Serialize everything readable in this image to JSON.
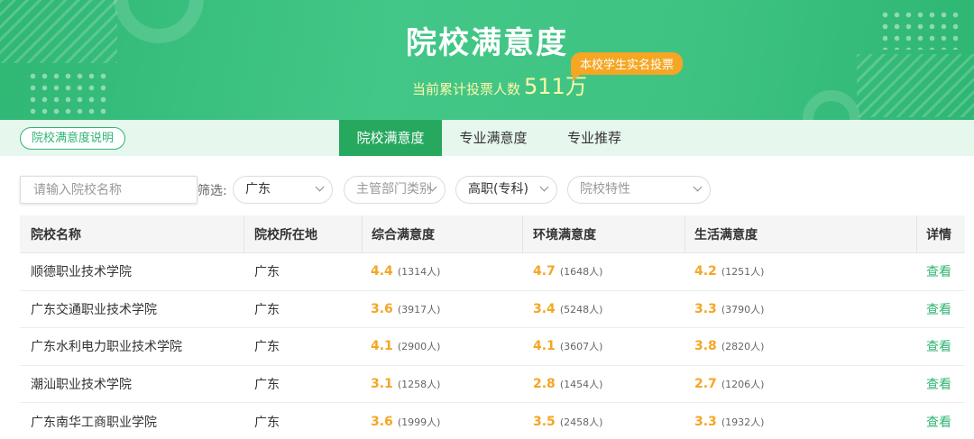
{
  "banner": {
    "title": "院校满意度",
    "vote_label": "当前累计投票人数",
    "vote_count": "511万",
    "badge": "本校学生实名投票"
  },
  "tabs": {
    "explain_button": "院校满意度说明",
    "items": [
      {
        "label": "院校满意度",
        "active": true
      },
      {
        "label": "专业满意度",
        "active": false
      },
      {
        "label": "专业推荐",
        "active": false
      }
    ]
  },
  "filters": {
    "search_placeholder": "请输入院校名称",
    "label": "筛选:",
    "region": "广东",
    "department_placeholder": "主管部门类别",
    "level": "高职(专科)",
    "feature_placeholder": "院校特性"
  },
  "table": {
    "headers": [
      "院校名称",
      "院校所在地",
      "综合满意度",
      "环境满意度",
      "生活满意度",
      "详情"
    ],
    "rows": [
      {
        "name": "顺德职业技术学院",
        "location": "广东",
        "overall": "4.4",
        "overall_count": "(1314人)",
        "env": "4.7",
        "env_count": "(1648人)",
        "life": "4.2",
        "life_count": "(1251人)",
        "detail": "查看"
      },
      {
        "name": "广东交通职业技术学院",
        "location": "广东",
        "overall": "3.6",
        "overall_count": "(3917人)",
        "env": "3.4",
        "env_count": "(5248人)",
        "life": "3.3",
        "life_count": "(3790人)",
        "detail": "查看"
      },
      {
        "name": "广东水利电力职业技术学院",
        "location": "广东",
        "overall": "4.1",
        "overall_count": "(2900人)",
        "env": "4.1",
        "env_count": "(3607人)",
        "life": "3.8",
        "life_count": "(2820人)",
        "detail": "查看"
      },
      {
        "name": "潮汕职业技术学院",
        "location": "广东",
        "overall": "3.1",
        "overall_count": "(1258人)",
        "env": "2.8",
        "env_count": "(1454人)",
        "life": "2.7",
        "life_count": "(1206人)",
        "detail": "查看"
      },
      {
        "name": "广东南华工商职业学院",
        "location": "广东",
        "overall": "3.6",
        "overall_count": "(1999人)",
        "env": "3.5",
        "env_count": "(2458人)",
        "life": "3.3",
        "life_count": "(1932人)",
        "detail": "查看"
      }
    ]
  },
  "colors": {
    "brand_green": "#2eb572",
    "score_orange": "#f5a623",
    "badge_orange": "#f5a623"
  }
}
